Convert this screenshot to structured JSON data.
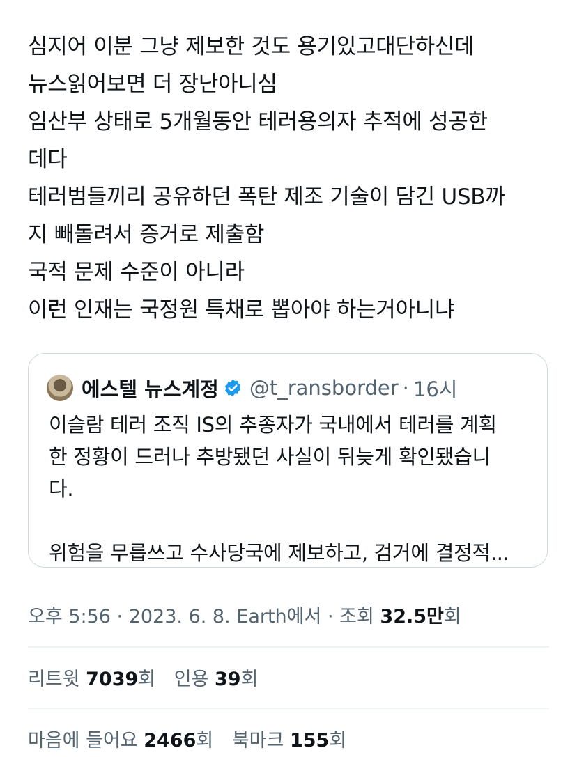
{
  "tweet": {
    "lines": [
      "심지어 이분 그냥 제보한 것도 용기있고대단하신데",
      "뉴스읽어보면 더 장난아니심",
      "임산부 상태로 5개월동안 테러용의자 추적에 성공한",
      "데다",
      "테러범들끼리 공유하던 폭탄 제조 기술이 담긴 USB까",
      "지 빼돌려서 증거로 제출함",
      "국적 문제 수준이 아니라",
      "이런 인재는 국정원 특채로 뽑아야 하는거아니냐"
    ]
  },
  "quote": {
    "name": "에스텔 뉴스계정",
    "handle": "@t_ransborder",
    "separator": "·",
    "time": "16시",
    "lines": [
      "이슬람 테러 조직 IS의 추종자가 국내에서 테러를 계획",
      "한 정황이 드러나 추방됐던 사실이 뒤늦게 확인됐습니",
      "다.",
      "",
      "위험을 무릅쓰고 수사당국에 제보하고, 검거에 결정적..."
    ],
    "verified_color": "#1d9bf0"
  },
  "meta": {
    "time": "오후 5:56",
    "sep1": "·",
    "date": "2023. 6. 8.",
    "source": "Earth에서",
    "sep2": "·",
    "views_label": "조회",
    "views_value": "32.5만",
    "views_suffix": "회"
  },
  "stats": {
    "retweets_label": "리트윗",
    "retweets_value": "7039",
    "retweets_suffix": "회",
    "quotes_label": "인용",
    "quotes_value": "39",
    "quotes_suffix": "회",
    "likes_label": "마음에 들어요",
    "likes_value": "2466",
    "likes_suffix": "회",
    "bookmarks_label": "북마크",
    "bookmarks_value": "155",
    "bookmarks_suffix": "회"
  },
  "colors": {
    "text": "#0f1419",
    "secondary": "#536471",
    "border": "#cfd9de",
    "accent": "#1d9bf0"
  }
}
